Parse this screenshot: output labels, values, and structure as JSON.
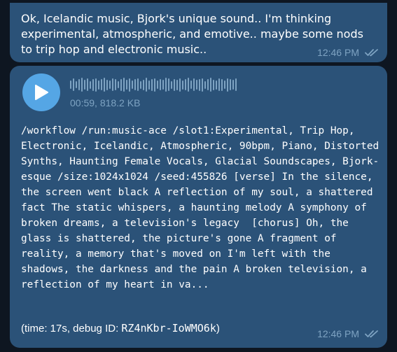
{
  "colors": {
    "background": "#0e1621",
    "bubble": "#2b5278",
    "accent": "#55a6e5",
    "meta": "#7ea3c2"
  },
  "message1": {
    "text": "Ok, Icelandic music, Bjork's unique sound.. I'm thinking experimental, atmospheric, and emotive.. maybe some nods to trip hop and electronic music..",
    "time": "12:46 PM",
    "status_icon": "double-check-icon"
  },
  "message2": {
    "play_icon": "play-icon",
    "duration": "00:59, 818.2 KB",
    "command": "/workflow /run:music-ace /slot1:Experimental, Trip Hop, Electronic, Icelandic, Atmospheric, 90bpm, Piano, Distorted Synths, Haunting Female Vocals, Glacial Soundscapes, Bjork-esque /size:1024x1024 /seed:455826 [verse] In the silence, the screen went black A reflection of my soul, a shattered fact The static whispers, a haunting melody A symphony of broken dreams, a television's legacy  [chorus] Oh, the glass is shattered, the picture's gone A fragment of reality, a memory that's moved on I'm left with the shadows, the darkness and the pain A broken television, a reflection of my heart in va...",
    "debug_prefix": "(time: 17s, debug ID: ",
    "debug_id": "RZ4nKbr-IoWMO6k",
    "debug_suffix": ")",
    "time": "12:46 PM",
    "status_icon": "double-check-icon"
  }
}
